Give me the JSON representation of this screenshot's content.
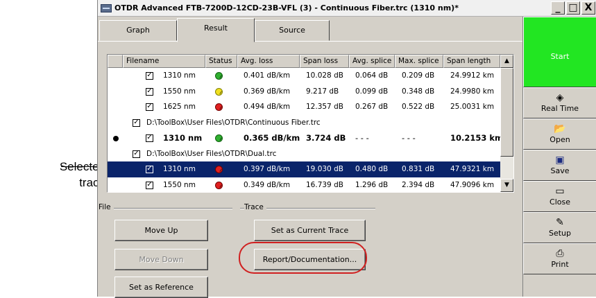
{
  "callout": {
    "line1": "Selected",
    "line2": "trace"
  },
  "window": {
    "title": "OTDR Advanced FTB-7200D-12CD-23B-VFL (3) - Continuous Fiber.trc (1310 nm)*",
    "controls": [
      "_",
      "□",
      "X"
    ]
  },
  "tabs": [
    {
      "label": "Graph"
    },
    {
      "label": "Result"
    },
    {
      "label": "Source"
    }
  ],
  "table": {
    "columns": [
      "Filename",
      "Status",
      "Avg. loss",
      "Span loss",
      "Avg. splice",
      "Max. splice",
      "Span length"
    ],
    "rows": [
      {
        "type": "trace",
        "wavelength": "1310 nm",
        "status": "ok",
        "avg_loss": "0.401 dB/km",
        "span_loss": "10.028 dB",
        "avg_splice": "0.064 dB",
        "max_splice": "0.209 dB",
        "span_length": "24.9912 km"
      },
      {
        "type": "trace",
        "wavelength": "1550 nm",
        "status": "warn",
        "avg_loss": "0.369 dB/km",
        "span_loss": "9.217 dB",
        "avg_splice": "0.099 dB",
        "max_splice": "0.348 dB",
        "span_length": "24.9980 km"
      },
      {
        "type": "trace",
        "wavelength": "1625 nm",
        "status": "fail",
        "avg_loss": "0.494 dB/km",
        "span_loss": "12.357 dB",
        "avg_splice": "0.267 dB",
        "max_splice": "0.522 dB",
        "span_length": "25.0031 km"
      },
      {
        "type": "file",
        "path": "D:\\ToolBox\\User Files\\OTDR\\Continuous Fiber.trc"
      },
      {
        "type": "trace",
        "current": true,
        "wavelength": "1310 nm",
        "status": "ok",
        "avg_loss": "0.365 dB/km",
        "span_loss": "3.724 dB",
        "avg_splice": "- - -",
        "max_splice": "- - -",
        "span_length": "10.2153 km"
      },
      {
        "type": "file",
        "path": "D:\\ToolBox\\User Files\\OTDR\\Dual.trc"
      },
      {
        "type": "trace",
        "selected": true,
        "wavelength": "1310 nm",
        "status": "fail",
        "avg_loss": "0.397 dB/km",
        "span_loss": "19.030 dB",
        "avg_splice": "0.480 dB",
        "max_splice": "0.831 dB",
        "span_length": "47.9321 km"
      },
      {
        "type": "trace",
        "wavelength": "1550 nm",
        "status": "fail",
        "avg_loss": "0.349 dB/km",
        "span_loss": "16.739 dB",
        "avg_splice": "1.296 dB",
        "max_splice": "2.394 dB",
        "span_length": "47.9096 km"
      }
    ]
  },
  "groups": {
    "file": "File",
    "trace": "Trace"
  },
  "buttons": {
    "move_up": "Move Up",
    "move_down": "Move Down",
    "set_reference": "Set as Reference",
    "set_current": "Set as Current Trace",
    "report": "Report/Documentation..."
  },
  "side": {
    "start": "Start",
    "real_time": "Real Time",
    "open": "Open",
    "save": "Save",
    "close": "Close",
    "setup": "Setup",
    "print": "Print"
  },
  "colors": {
    "selection": "#0a246a",
    "start_green": "#22e622",
    "highlight": "#d02020"
  }
}
